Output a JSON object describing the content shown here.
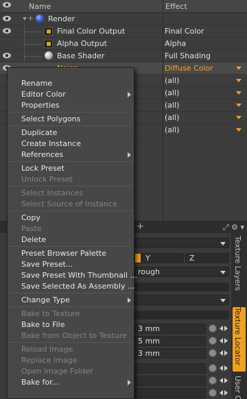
{
  "tree": {
    "header": {
      "name_col": "Name",
      "effect_col": "Effect"
    },
    "rows": [
      {
        "name": "Render",
        "effect": ""
      },
      {
        "name": "Final Color Output",
        "effect": "Final Color"
      },
      {
        "name": "Alpha Output",
        "effect": "Alpha"
      },
      {
        "name": "Base Shader",
        "effect": "Full Shading"
      },
      {
        "name": "Noise",
        "effect": "Diffuse Color"
      },
      {
        "name": "",
        "effect": "(all)"
      },
      {
        "name": "",
        "effect": "(all)"
      },
      {
        "name": "",
        "effect": "(all)"
      },
      {
        "name": "",
        "effect": "(all)"
      },
      {
        "name": "",
        "effect": "(all)"
      }
    ],
    "accent_color": "#f0a020"
  },
  "lower_panel": {
    "tab_add": "+",
    "side_tabs": [
      "Texture Layers",
      "Texture Locator",
      "User Chan"
    ],
    "axis": {
      "y": "Y",
      "z": "Z"
    },
    "dropdown_text": "rough",
    "value_suffixes": [
      "3 mm",
      "5 mm",
      "3 mm"
    ]
  },
  "context_menu": {
    "items": [
      {
        "label": "Rename",
        "enabled": true,
        "submenu": false
      },
      {
        "label": "Editor Color",
        "enabled": true,
        "submenu": true
      },
      {
        "label": "Properties",
        "enabled": true,
        "submenu": false
      },
      {
        "label": "Select Polygons",
        "enabled": true,
        "submenu": false
      },
      {
        "label": "Duplicate",
        "enabled": true,
        "submenu": false
      },
      {
        "label": "Create Instance",
        "enabled": true,
        "submenu": false
      },
      {
        "label": "References",
        "enabled": true,
        "submenu": true
      },
      {
        "label": "Lock Preset",
        "enabled": true,
        "submenu": false
      },
      {
        "label": "Unlock Preset",
        "enabled": false,
        "submenu": false
      },
      {
        "label": "Select Instances",
        "enabled": false,
        "submenu": false
      },
      {
        "label": "Select Source of Instance",
        "enabled": false,
        "submenu": false
      },
      {
        "label": "Copy",
        "enabled": true,
        "submenu": false
      },
      {
        "label": "Paste",
        "enabled": false,
        "submenu": false
      },
      {
        "label": "Delete",
        "enabled": true,
        "submenu": false
      },
      {
        "label": "Preset Browser Palette",
        "enabled": true,
        "submenu": false
      },
      {
        "label": "Save Preset...",
        "enabled": true,
        "submenu": false
      },
      {
        "label": "Save Preset With Thumbnail ...",
        "enabled": true,
        "submenu": false
      },
      {
        "label": "Save Selected As Assembly ...",
        "enabled": true,
        "submenu": false
      },
      {
        "label": "Change Type",
        "enabled": true,
        "submenu": true
      },
      {
        "label": "Bake to Texture",
        "enabled": false,
        "submenu": false
      },
      {
        "label": "Bake to File",
        "enabled": true,
        "submenu": false
      },
      {
        "label": "Bake from Object to Texture",
        "enabled": false,
        "submenu": false
      },
      {
        "label": "Reload Image",
        "enabled": false,
        "submenu": false
      },
      {
        "label": "Replace Image",
        "enabled": false,
        "submenu": false
      },
      {
        "label": "Open Image Folder",
        "enabled": false,
        "submenu": false
      },
      {
        "label": "Bake for...",
        "enabled": true,
        "submenu": true
      }
    ]
  }
}
